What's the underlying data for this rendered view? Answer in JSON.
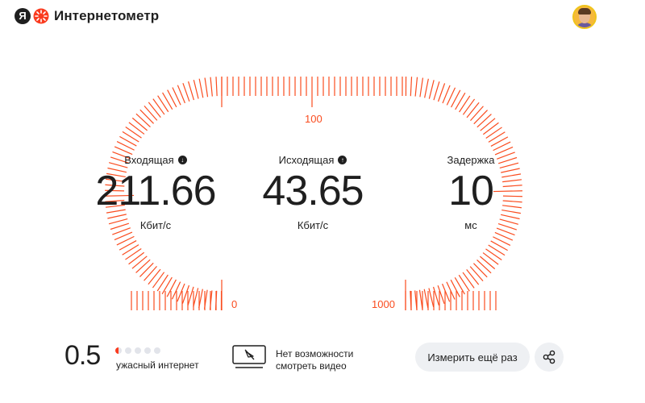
{
  "header": {
    "logo_letter": "Я",
    "app_title": "Интернетометр"
  },
  "gauge": {
    "accent_color": "#fa4c1f",
    "label_top": "100",
    "label_zero": "0",
    "label_max": "1000"
  },
  "metrics": {
    "download": {
      "label": "Входящая",
      "value": "211.66",
      "unit": "Кбит/с",
      "icon": "download-icon"
    },
    "upload": {
      "label": "Исходящая",
      "value": "43.65",
      "unit": "Кбит/с",
      "icon": "upload-icon"
    },
    "latency": {
      "label": "Задержка",
      "value": "10",
      "unit": "мс"
    }
  },
  "rating": {
    "score": "0.5",
    "max_dots": 5,
    "filled": 0.5,
    "description": "ужасный интернет"
  },
  "video": {
    "line1": "Нет возможности",
    "line2": "смотреть видео",
    "icon": "video-off-icon"
  },
  "actions": {
    "retry_label": "Измерить ещё раз",
    "share_icon": "share-icon"
  }
}
